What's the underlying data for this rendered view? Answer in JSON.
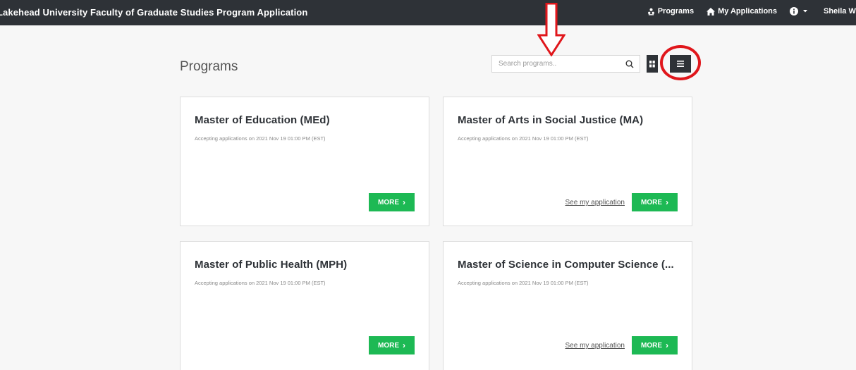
{
  "header": {
    "app_title": "Lakehead University Faculty of Graduate Studies Program Application",
    "nav": {
      "programs": "Programs",
      "my_applications": "My Applications",
      "user": "Sheila W..."
    }
  },
  "main": {
    "title": "Programs",
    "search": {
      "placeholder": "Search programs.."
    },
    "view_toggle": {
      "grid_icon": "grid-icon",
      "list_icon": "list-icon"
    }
  },
  "programs": [
    {
      "name": "Master of Education (MEd)",
      "status": "Accepting applications on 2021 Nov 19 01:00 PM (EST)",
      "see_link": "",
      "more": "MORE"
    },
    {
      "name": "Master of Arts in Social Justice (MA)",
      "status": "Accepting applications on 2021 Nov 19 01:00 PM (EST)",
      "see_link": "See my application",
      "more": "MORE"
    },
    {
      "name": "Master of Public Health (MPH)",
      "status": "Accepting applications on 2021 Nov 19 01:00 PM (EST)",
      "see_link": "",
      "more": "MORE"
    },
    {
      "name": "Master of Science in Computer Science (...",
      "status": "Accepting applications on 2021 Nov 19 01:00 PM (EST)",
      "see_link": "See my application",
      "more": "MORE"
    }
  ],
  "colors": {
    "topbar": "#2e3237",
    "accent_green": "#1db954",
    "annotation_red": "#e0161b"
  }
}
